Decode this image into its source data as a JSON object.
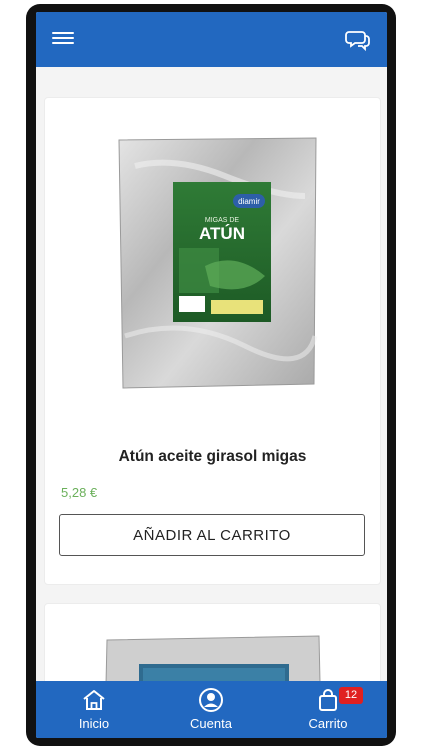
{
  "product": {
    "name": "Atún aceite girasol migas",
    "price": "5,28 €",
    "add_button_label": "AÑADIR AL CARRITO",
    "package": {
      "brand": "diamir",
      "line1": "MIGAS DE",
      "line2": "ATÚN"
    }
  },
  "bottom_nav": {
    "home_label": "Inicio",
    "account_label": "Cuenta",
    "cart_label": "Carrito",
    "cart_count": "12"
  },
  "colors": {
    "primary": "#2268c0",
    "price": "#6bb05b",
    "badge": "#e02020"
  }
}
